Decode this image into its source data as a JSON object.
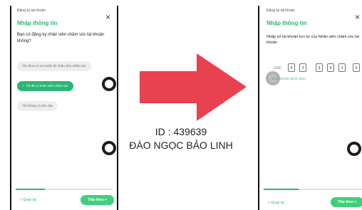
{
  "left_screen": {
    "small_title": "Đăng ký tài khoản",
    "heading": "Nhập thông tin",
    "question": "Bạn có đăng ký nhân viên chăm sóc tài khoản không?",
    "options": [
      {
        "label": "Tôi chưa có và muốn ẩn nhân viên chăm sóc",
        "selected": false
      },
      {
        "label": "✓ Tôi đã có nhân viên chăm sóc",
        "selected": true
      },
      {
        "label": "Tôi không có nhu cầu",
        "selected": false
      }
    ],
    "back_label": "< Quay lại",
    "next_label": "Tiếp theo >",
    "progress": 0.3
  },
  "right_screen": {
    "small_title": "Đăng ký tài khoản",
    "heading": "Nhập thông tin",
    "instruction": "Nhập số tài khoản lưu ký của Nhân viên chăm sóc tài khoản",
    "prefix": "116C",
    "digits": [
      "4",
      "3",
      "9",
      "6",
      "3",
      "9"
    ],
    "staff_name": "ĐÀO NGỌC BẢO LINH",
    "back_label": "< Quay lại",
    "next_label": "Tiếp theo >",
    "progress": 0.35
  },
  "center": {
    "id_text": "ID : 439639",
    "name_text": "ĐÀO NGỌC BẢO LINH",
    "arrow_color": "#e8414f"
  },
  "icons": {
    "close": "close-icon",
    "arrow": "arrow-right-icon"
  }
}
